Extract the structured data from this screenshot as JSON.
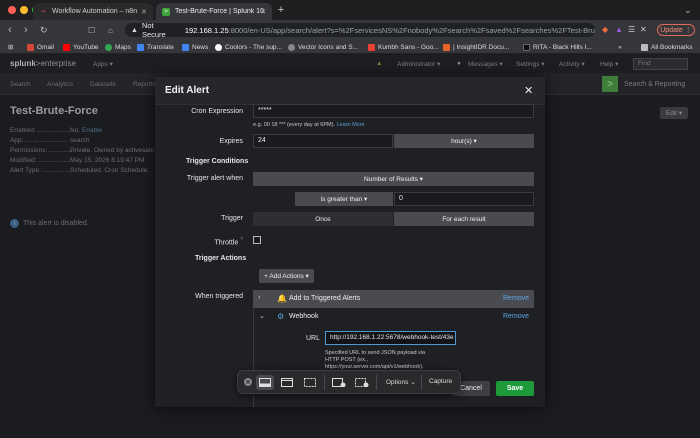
{
  "colors": {
    "accent": "#5ca8e6",
    "save": "#1f9a3a",
    "update": "#e06a5a"
  },
  "browser": {
    "tabs": [
      {
        "label": "Workflow Automation – n8n",
        "icon": "n8n-icon",
        "active": false
      },
      {
        "label": "Test-Brute-Force | Splunk 10.2",
        "icon": "splunk-icon",
        "active": true
      }
    ],
    "url": {
      "warning": "Not Secure",
      "host": "192.168.1.25",
      "path": ":8000/en-US/app/search/alert?s=%2FservicesNS%2Fnobody%2Fsearch%2Fsaved%2Fsearches%2FTest-Brute-Force"
    },
    "update_label": "Update",
    "bookmarks": [
      "Gmail",
      "YouTube",
      "Maps",
      "Translate",
      "News",
      "Coolors - The sup...",
      "Vector Icons and S...",
      "Kumbh Sans - Goo...",
      "| InsightIDR Docu...",
      "RITA - Black Hills I..."
    ],
    "all_bookmarks": "All Bookmarks"
  },
  "splunk": {
    "logo_prefix": "splunk",
    "logo_suffix": ">enterprise",
    "apps_label": "Apps ▾",
    "nav": [
      "Administrator ▾",
      "Messages ▾",
      "Settings ▾",
      "Activity ▾",
      "Help ▾"
    ],
    "find_placeholder": "Find",
    "app_tabs": [
      "Search",
      "Analytics",
      "Datasets",
      "Reports"
    ],
    "app_name": "Search & Reporting",
    "page_title": "Test-Brute-Force",
    "edit_label": "Edit ▾",
    "meta": [
      {
        "k": "Enabled: ...................",
        "v": "No.",
        "link": "Enable"
      },
      {
        "k": "App: .......................",
        "v": "search",
        "link": ""
      },
      {
        "k": "Permissions: ...............",
        "v": "Private. Owned by activesam",
        "link": ""
      },
      {
        "k": "Modified: ..................",
        "v": "May 15, 2026 8:19:47 PM",
        "link": ""
      },
      {
        "k": "Alert Type: ................",
        "v": "Scheduled. Cron Schedule.",
        "link": ""
      }
    ],
    "disabled_note": "This alert is disabled."
  },
  "modal": {
    "title": "Edit Alert",
    "cron_label": "Cron Expression",
    "cron_value": "*****",
    "cron_hint": "e.g. 00 18 *** (every day at 6PM).",
    "learn_more": "Learn More",
    "expires_label": "Expires",
    "expires_value": "24",
    "expires_unit": "hour(s) ▾",
    "trigger_conditions": "Trigger Conditions",
    "trigger_when_label": "Trigger alert when",
    "trigger_when_value": "Number of Results ▾",
    "comparator": "is greater than ▾",
    "threshold": "0",
    "trigger_label": "Trigger",
    "trigger_once": "Once",
    "trigger_each": "For each result",
    "throttle_label": "Throttle",
    "throttle_help": "?",
    "trigger_actions": "Trigger Actions",
    "add_actions": "+ Add Actions ▾",
    "when_triggered": "When triggered",
    "actions": [
      {
        "name": "Add to Triggered Alerts",
        "remove": "Remove"
      },
      {
        "name": "Webhook",
        "remove": "Remove"
      }
    ],
    "url_label": "URL",
    "url_value": "http://192.168.1.22:5678/webhook-test/43e",
    "url_hint_1": "Specified URL to send JSON payload via",
    "url_hint_2": "HTTP POST (ex.,",
    "url_hint_3": "https://your.server.com/api/v1/webhook).",
    "cancel": "Cancel",
    "save": "Save"
  },
  "capture_toolbar": {
    "options": "Options ⌄",
    "capture": "Capture"
  }
}
